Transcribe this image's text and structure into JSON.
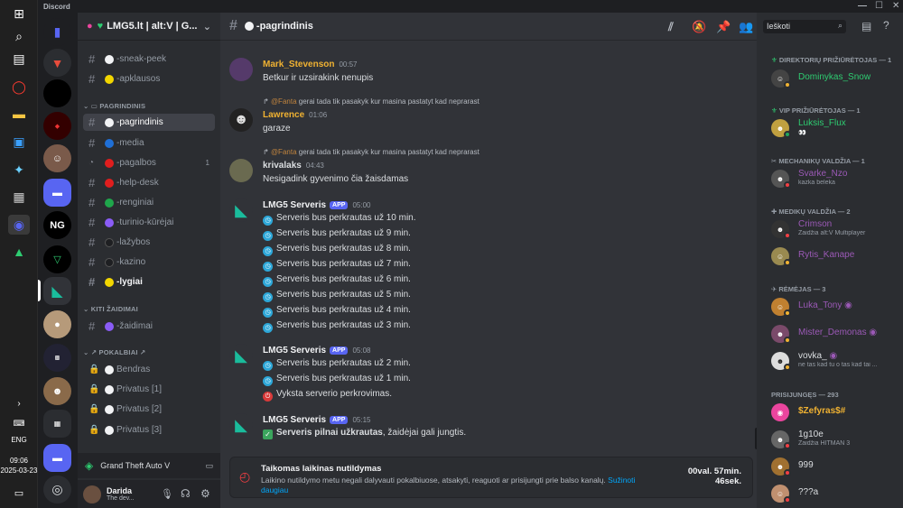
{
  "app": {
    "title": "Discord"
  },
  "taskbar": {
    "time": "09:06",
    "date": "2025-03-23",
    "lang": "ENG"
  },
  "guild": {
    "name": "LMG5.lt | alt:V | G..."
  },
  "channels": {
    "top": [
      {
        "name": "-sneak-peek",
        "color": "#f2f3f5"
      },
      {
        "name": "-apklausos",
        "color": "#f2d600"
      }
    ],
    "cat_main": "PAGRINDINIS",
    "main": [
      {
        "name": "-pagrindinis",
        "color": "#f2f3f5",
        "selected": true
      },
      {
        "name": "-media",
        "color": "#1f6fd6"
      },
      {
        "name": "-pagalbos",
        "color": "#e01e1e",
        "badge": "1"
      },
      {
        "name": "-help-desk",
        "color": "#e01e1e"
      },
      {
        "name": "-renginiai",
        "color": "#1fa64b"
      },
      {
        "name": "-turinio-kūrėjai",
        "color": "#8a5cf6"
      },
      {
        "name": "-lažybos",
        "color": "#1e1f22"
      },
      {
        "name": "-kazino",
        "color": "#1e1f22"
      },
      {
        "name": "-lygiai",
        "color": "#f2d600",
        "unread": true
      }
    ],
    "cat_other": "KITI ŽAIDIMAI",
    "other": [
      {
        "name": "-žaidimai",
        "color": "#8a5cf6"
      }
    ],
    "cat_voice": "POKALBIAI",
    "voice": [
      "Bendras",
      "Privatus [1]",
      "Privatus [2]",
      "Privatus [3]"
    ]
  },
  "activity": {
    "game": "Grand Theft Auto V"
  },
  "user": {
    "name": "Darida",
    "status": "The dev..."
  },
  "header": {
    "channel": "-pagrindinis",
    "search_placeholder": "Ieškoti"
  },
  "messages": [
    {
      "author": "Mark_Stevenson",
      "color": "#f0b232",
      "time": "00:57",
      "lines": [
        "Betkur ir uzsirakink nenupis"
      ]
    },
    {
      "reply_to": "@Fanta",
      "reply_text": "gerai tada tik pasakyk kur masina pastatyt kad neprarast",
      "author": "Lawrence",
      "color": "#f0b232",
      "time": "01:06",
      "lines": [
        "garaze"
      ]
    },
    {
      "reply_to": "@Fanta",
      "reply_text": "gerai tada tik pasakyk kur masina pastatyt kad neprarast",
      "author": "krivalaks",
      "color": "#dbdee1",
      "time": "04:43",
      "lines": [
        "Nesigadink gyvenimo čia žaisdamas"
      ]
    },
    {
      "author": "LMG5 Serveris",
      "app": "APP",
      "color": "#f2f3f5",
      "time": "05:00",
      "lines": [
        "Serveris bus perkrautas už 10 min.",
        "Serveris bus perkrautas už 9 min.",
        "Serveris bus perkrautas už 8 min.",
        "Serveris bus perkrautas už 7 min.",
        "Serveris bus perkrautas už 6 min.",
        "Serveris bus perkrautas už 5 min.",
        "Serveris bus perkrautas už 4 min.",
        "Serveris bus perkrautas už 3 min."
      ]
    },
    {
      "author": "LMG5 Serveris",
      "app": "APP",
      "color": "#f2f3f5",
      "time": "05:08",
      "lines": [
        "Serveris bus perkrautas už 2 min.",
        "Serveris bus perkrautas už 1 min.",
        "Vyksta serverio perkrovimas."
      ]
    },
    {
      "author": "LMG5 Serveris",
      "app": "APP",
      "color": "#f2f3f5",
      "time": "05:15",
      "bold": "Serveris pilnai užkrautas",
      "rest": ", žaidėjai gali jungtis."
    }
  ],
  "notice": {
    "title": "Taikomas laikinas nutildymas",
    "text": "Laikino nutildymo metu negali dalyvauti pokalbiuose, atsakyti, reaguoti ar prisijungti prie balso kanalų.",
    "link": "Sužinoti daugiau",
    "timer1": "00val. 57min.",
    "timer2": "46sek."
  },
  "members": {
    "groups": [
      {
        "title": "DIREKTORIŲ PRIŽIŪRĖTOJAS — 1",
        "items": [
          {
            "name": "Dominykas_Snow",
            "color": "#2ecc71"
          }
        ]
      },
      {
        "title": "VIP PRIŽIŪRĖTOJAS — 1",
        "items": [
          {
            "name": "Luksis_Flux",
            "color": "#2ecc71",
            "sub": "👀"
          }
        ]
      },
      {
        "title": "MECHANIKŲ VALDŽIA — 1",
        "items": [
          {
            "name": "Svarke_Nzo",
            "color": "#9b59b6",
            "sub": "kazka beleka"
          }
        ]
      },
      {
        "title": "MEDIKŲ VALDŽIA — 2",
        "items": [
          {
            "name": "Crimson",
            "color": "#9b59b6",
            "sub": "Žaidžia alt:V Multiplayer"
          },
          {
            "name": "Rytis_Kanape",
            "color": "#9b59b6"
          }
        ]
      },
      {
        "title": "RĖMĖJAS — 3",
        "items": [
          {
            "name": "Luka_Tony",
            "color": "#9b59b6"
          },
          {
            "name": "Mister_Demonas",
            "color": "#9b59b6"
          },
          {
            "name": "vovka_",
            "color": "#dbdee1",
            "sub": "ne tas kad tu o tas kad tai ..."
          }
        ]
      },
      {
        "title": "PRISIJUNGĘS — 293",
        "items": [
          {
            "name": "$Zefyras$#",
            "color": "#f0b232"
          },
          {
            "name": "1g10e",
            "color": "#dbdee1",
            "sub": "Žaidžia HITMAN 3"
          },
          {
            "name": "999",
            "color": "#dbdee1"
          },
          {
            "name": "???a",
            "color": "#dbdee1"
          }
        ]
      }
    ]
  }
}
